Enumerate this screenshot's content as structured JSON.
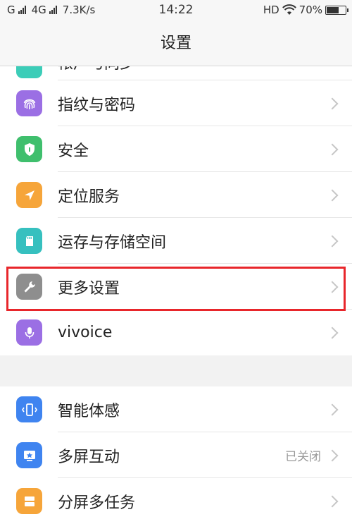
{
  "status_bar": {
    "left": "G",
    "network": "4G",
    "speed": "7.3K/s",
    "time": "14:22",
    "hd": "HD",
    "battery": "70%",
    "battery_level": 0.7
  },
  "header": {
    "title": "设置"
  },
  "items": [
    {
      "label": "帐户与同步",
      "icon": "sync-icon",
      "color": "#3ccdb8"
    },
    {
      "label": "指纹与密码",
      "icon": "fingerprint-icon",
      "color": "#9b6fe4"
    },
    {
      "label": "安全",
      "icon": "shield-icon",
      "color": "#3fbf6d"
    },
    {
      "label": "定位服务",
      "icon": "location-arrow-icon",
      "color": "#f6a53a"
    },
    {
      "label": "运存与存储空间",
      "icon": "sd-card-icon",
      "color": "#36c0bf"
    },
    {
      "label": "更多设置",
      "icon": "wrench-icon",
      "color": "#8e8e8e"
    },
    {
      "label": "vivoice",
      "icon": "microphone-icon",
      "color": "#9b6fe4"
    },
    {
      "label": "智能体感",
      "icon": "phone-motion-icon",
      "color": "#3f84f0"
    },
    {
      "label": "多屏互动",
      "icon": "screen-cast-icon",
      "color": "#3f84f0",
      "value": "已关闭"
    },
    {
      "label": "分屏多任务",
      "icon": "split-screen-icon",
      "color": "#f6a53a"
    }
  ],
  "highlight_color": "#e8262b"
}
